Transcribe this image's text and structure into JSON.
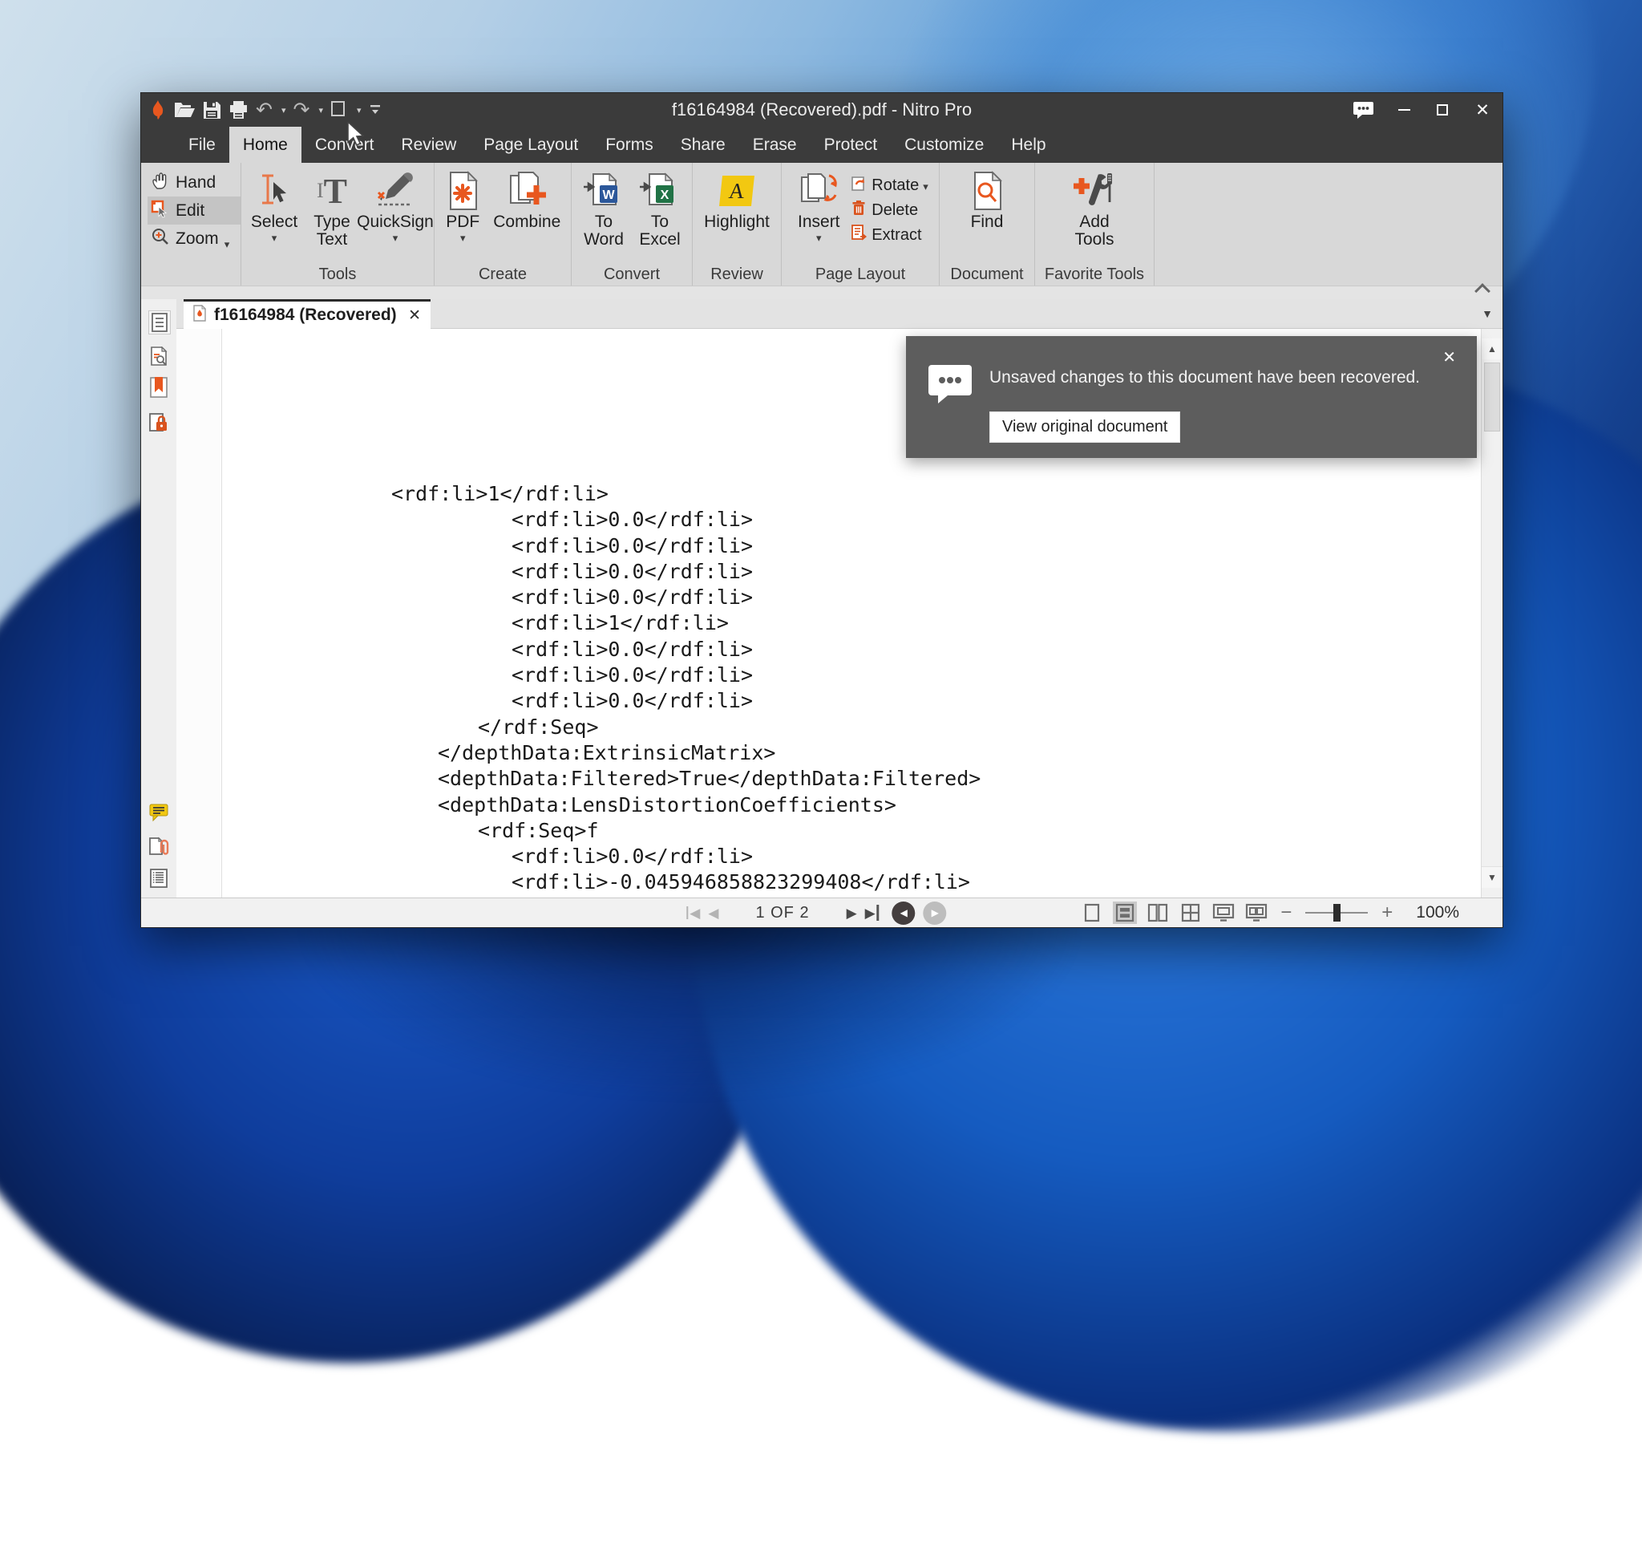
{
  "window": {
    "title": "f16164984 (Recovered).pdf - Nitro Pro"
  },
  "menubar": {
    "items": [
      {
        "label": "File"
      },
      {
        "label": "Home",
        "active": true
      },
      {
        "label": "Convert"
      },
      {
        "label": "Review"
      },
      {
        "label": "Page Layout"
      },
      {
        "label": "Forms"
      },
      {
        "label": "Share"
      },
      {
        "label": "Erase"
      },
      {
        "label": "Protect"
      },
      {
        "label": "Customize"
      },
      {
        "label": "Help"
      }
    ]
  },
  "ribbon": {
    "mode_buttons": [
      {
        "label": "Hand"
      },
      {
        "label": "Edit",
        "active": true
      },
      {
        "label": "Zoom",
        "caret": true
      }
    ],
    "groups": [
      {
        "label": "Tools",
        "buttons": [
          {
            "label": "Select",
            "caret": true
          },
          {
            "label": "Type\nText"
          },
          {
            "label": "QuickSign",
            "caret": true
          }
        ]
      },
      {
        "label": "Create",
        "buttons": [
          {
            "label": "PDF",
            "caret": true
          },
          {
            "label": "Combine"
          }
        ]
      },
      {
        "label": "Convert",
        "buttons": [
          {
            "label": "To\nWord"
          },
          {
            "label": "To\nExcel"
          }
        ]
      },
      {
        "label": "Review",
        "buttons": [
          {
            "label": "Highlight"
          }
        ]
      },
      {
        "label": "Page Layout",
        "buttons": [
          {
            "label": "Insert",
            "caret": true
          }
        ],
        "small_buttons": [
          {
            "label": "Rotate",
            "caret": true
          },
          {
            "label": "Delete"
          },
          {
            "label": "Extract"
          }
        ]
      },
      {
        "label": "Document",
        "buttons": [
          {
            "label": "Find"
          }
        ]
      },
      {
        "label": "Favorite Tools",
        "buttons": [
          {
            "label": "Add\nTools"
          }
        ]
      }
    ]
  },
  "tabbar": {
    "tab_label": "f16164984 (Recovered)"
  },
  "sidebar": {
    "icons": [
      "page-thumbnails-icon",
      "search-document-icon",
      "bookmarks-icon",
      "secure-document-icon",
      "comments-icon",
      "attachments-icon",
      "output-list-icon"
    ]
  },
  "document": {
    "lines": [
      {
        "text": "<rdf:li>1</rdf:li>",
        "indent": 268
      },
      {
        "text": "<rdf:li>0.0</rdf:li>",
        "indent": 418
      },
      {
        "text": "<rdf:li>0.0</rdf:li>",
        "indent": 418
      },
      {
        "text": "<rdf:li>0.0</rdf:li>",
        "indent": 418
      },
      {
        "text": "<rdf:li>0.0</rdf:li>",
        "indent": 418
      },
      {
        "text": "<rdf:li>1</rdf:li>",
        "indent": 418
      },
      {
        "text": "<rdf:li>0.0</rdf:li>",
        "indent": 418
      },
      {
        "text": "<rdf:li>0.0</rdf:li>",
        "indent": 418
      },
      {
        "text": "<rdf:li>0.0</rdf:li>",
        "indent": 418
      },
      {
        "text": "</rdf:Seq>",
        "indent": 376
      },
      {
        "text": "</depthData:ExtrinsicMatrix>",
        "indent": 326
      },
      {
        "text": "<depthData:Filtered>True</depthData:Filtered>",
        "indent": 326
      },
      {
        "text": "<depthData:LensDistortionCoefficients>",
        "indent": 326
      },
      {
        "text": "<rdf:Seq>f",
        "indent": 376
      },
      {
        "text": "<rdf:li>0.0</rdf:li>",
        "indent": 418
      },
      {
        "text": "<rdf:li>-0.045946858823299408</rdf:li>",
        "indent": 418
      }
    ]
  },
  "notification": {
    "message": "Unsaved changes to this document have been recovered.",
    "button_label": "View original document"
  },
  "statusbar": {
    "page_indicator": "1 OF 2",
    "zoom_level": "100%"
  },
  "colors": {
    "accent_orange": "#e8571f",
    "titlebar_bg": "#3b3b3b",
    "ribbon_bg": "#d8d8d8",
    "highlight_yellow": "#f2c811",
    "word_blue": "#2b579a",
    "excel_green": "#217346",
    "notification_bg": "#5d5d5d"
  }
}
